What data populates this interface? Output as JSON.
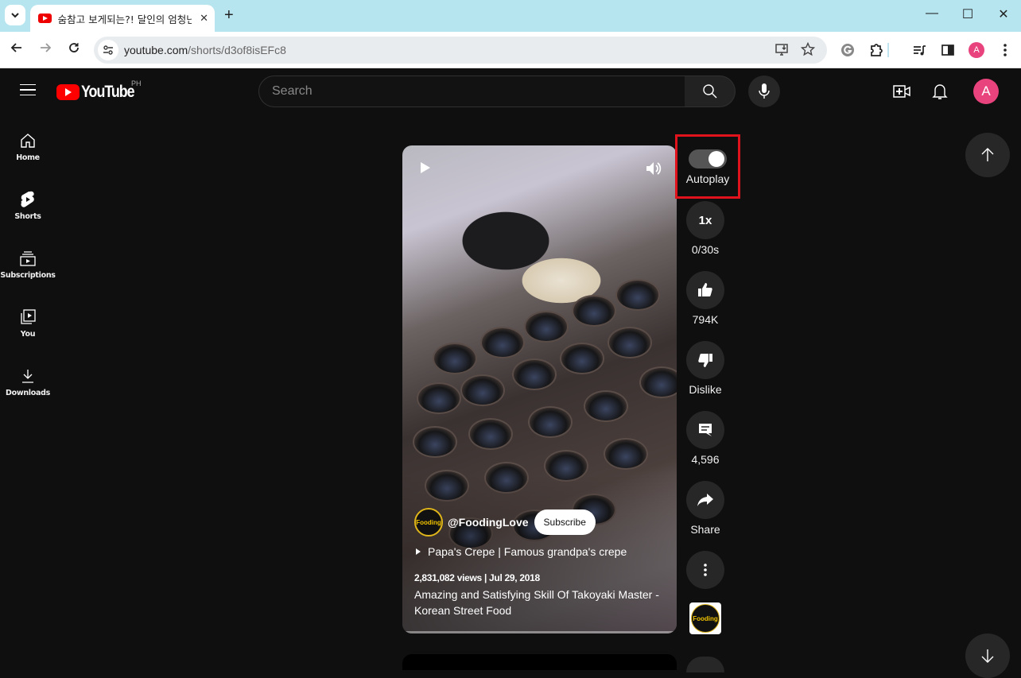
{
  "browser": {
    "tab_title": "숨참고 보게되는?! 달인의 엄청난",
    "url_host": "youtube.com",
    "url_path": "/shorts/d3of8isEFc8",
    "profile_initial": "A",
    "icons": {
      "tab_list": "chevron-down-icon",
      "close_tab": "close-icon",
      "new_tab": "plus-icon",
      "back": "arrow-left-icon",
      "forward": "arrow-right-icon",
      "reload": "reload-icon",
      "site_info": "tune-icon",
      "install": "install-app-icon",
      "bookmark": "star-icon",
      "grammarly": "grammarly-icon",
      "extensions": "puzzle-icon",
      "media": "media-control-icon",
      "side_panel": "side-panel-icon",
      "menu": "kebab-menu-icon"
    },
    "window": {
      "minimize": "—",
      "maximize": "☐",
      "close": "✕"
    }
  },
  "header": {
    "logo_text": "YouTube",
    "region": "PH",
    "search_placeholder": "Search",
    "avatar_initial": "A"
  },
  "sidebar": {
    "items": [
      {
        "label": "Home",
        "icon": "home-icon"
      },
      {
        "label": "Shorts",
        "icon": "shorts-icon"
      },
      {
        "label": "Subscriptions",
        "icon": "subscriptions-icon"
      },
      {
        "label": "You",
        "icon": "library-icon"
      },
      {
        "label": "Downloads",
        "icon": "download-icon"
      }
    ]
  },
  "short": {
    "channel_handle": "@FoodingLove",
    "channel_avatar_text": "Fooding",
    "subscribe_label": "Subscribe",
    "playlist": "Papa's Crepe | Famous grandpa's crepe",
    "meta": "2,831,082 views | Jul 29, 2018",
    "title": "Amazing and Satisfying Skill Of Takoyaki Master - Korean Street Food",
    "progress_percent": 1
  },
  "actions": {
    "autoplay_label": "Autoplay",
    "autoplay_on": true,
    "speed_label": "1x",
    "speed_sub": "0/30s",
    "like_count": "794K",
    "dislike_label": "Dislike",
    "comment_count": "4,596",
    "share_label": "Share"
  }
}
